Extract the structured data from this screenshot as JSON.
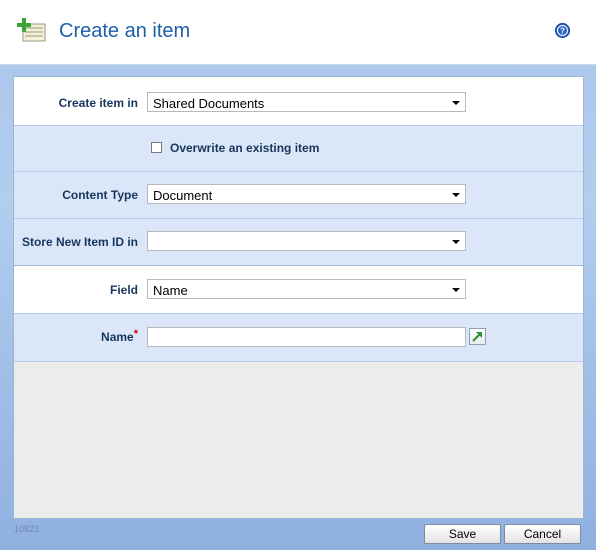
{
  "header": {
    "title": "Create an item",
    "app_icon": "add-item-icon",
    "help_icon": "help-icon"
  },
  "form": {
    "create_in": {
      "label": "Create item in",
      "value": "Shared Documents"
    },
    "overwrite": {
      "label": "Overwrite an existing item",
      "checked": false
    },
    "content_type": {
      "label": "Content Type",
      "value": "Document"
    },
    "store_id": {
      "label": "Store New Item ID in",
      "value": ""
    },
    "field": {
      "label": "Field",
      "value": "Name"
    },
    "name": {
      "label": "Name",
      "required_mark": "*",
      "value": ""
    }
  },
  "footer": {
    "id": "10823",
    "save_label": "Save",
    "cancel_label": "Cancel"
  },
  "colors": {
    "title": "#1e5fa8",
    "label": "#17365d",
    "row_blue": "#dbe6f8",
    "required": "#e00000"
  }
}
